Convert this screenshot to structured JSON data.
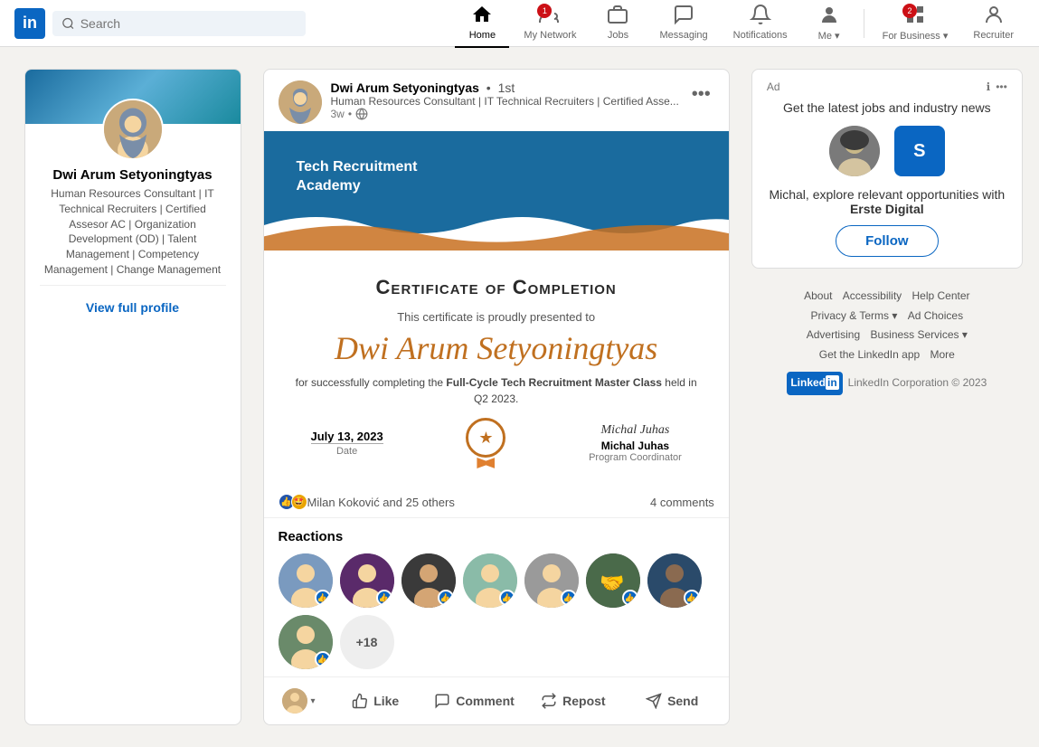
{
  "navbar": {
    "logo": "in",
    "search_placeholder": "Search",
    "nav_items": [
      {
        "id": "home",
        "label": "Home",
        "active": true,
        "badge": null
      },
      {
        "id": "network",
        "label": "My Network",
        "active": false,
        "badge": "1"
      },
      {
        "id": "jobs",
        "label": "Jobs",
        "active": false,
        "badge": null
      },
      {
        "id": "messaging",
        "label": "Messaging",
        "active": false,
        "badge": null
      },
      {
        "id": "notifications",
        "label": "Notifications",
        "active": false,
        "badge": null
      },
      {
        "id": "me",
        "label": "Me",
        "active": false,
        "badge": null
      },
      {
        "id": "for_business",
        "label": "For Business",
        "active": false,
        "badge": "2"
      },
      {
        "id": "recruiter",
        "label": "Recruiter",
        "active": false,
        "badge": null
      }
    ]
  },
  "sidebar": {
    "profile_name": "Dwi Arum Setyoningtyas",
    "profile_title": "Human Resources Consultant | IT Technical Recruiters | Certified Assesor AC | Organization Development (OD) | Talent Management | Competency Management | Change Management",
    "view_profile_label": "View full profile"
  },
  "post": {
    "author_name": "Dwi Arum Setyoningtyas",
    "connection_level": "1st",
    "author_title": "Human Resources Consultant | IT Technical Recruiters | Certified Asse...",
    "time_ago": "3w",
    "visibility": "Public",
    "cert": {
      "academy_name": "Tech Recruitment",
      "academy_name2": "Academy",
      "main_title": "Certificate of Completion",
      "presented_to": "This certificate is proudly presented to",
      "recipient_name": "Dwi Arum Setyoningtyas",
      "description_pre": "for successfully completing the ",
      "course_name": "Full-Cycle Tech Recruitment Master Class",
      "description_post": " held in Q2 2023.",
      "date_value": "July 13, 2023",
      "date_label": "Date",
      "signatory_signature": "Michal Juhas",
      "signatory_name": "Michal Juhas",
      "signatory_role": "Program Coordinator"
    },
    "reactions_summary": "Milan Koković and 25 others",
    "comments_count": "4 comments",
    "reactions_section_title": "Reactions",
    "more_reactions_count": "+18",
    "actions": {
      "like": "Like",
      "comment": "Comment",
      "repost": "Repost",
      "send": "Send"
    }
  },
  "ad": {
    "label": "Ad",
    "description": "Get the latest jobs and industry news",
    "cta_text_pre": "Michal, explore relevant opportunities with ",
    "company_bold": "Erste Digital",
    "follow_label": "Follow"
  },
  "footer": {
    "links": [
      "About",
      "Accessibility",
      "Help Center",
      "Privacy & Terms",
      "Ad Choices",
      "Advertising",
      "Business Services",
      "Get the LinkedIn app",
      "More"
    ],
    "copyright": "LinkedIn Corporation © 2023"
  }
}
